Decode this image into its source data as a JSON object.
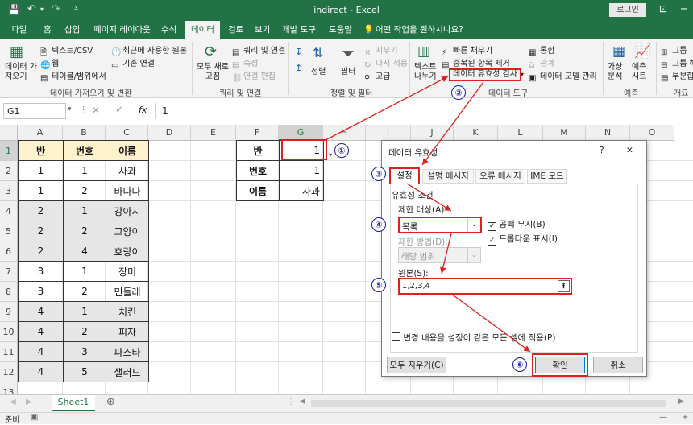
{
  "window": {
    "file": "indirect",
    "app": "Excel",
    "title_sep": "  -  ",
    "login": "로그인"
  },
  "tabs": [
    "파일",
    "홈",
    "삽입",
    "페이지 레이아웃",
    "수식",
    "데이터",
    "검토",
    "보기",
    "개발 도구",
    "도움말"
  ],
  "tell_me": "어떤 작업을 원하시나요?",
  "ribbon": {
    "get_data": "데이터 가\n져오기",
    "from_csv": "텍스트/CSV",
    "from_web": "웹",
    "from_table": "테이블/범위에서",
    "recent_sources": "최근에 사용한 원본",
    "existing_conn": "기존 연결",
    "refresh_all": "모두 새로\n고침",
    "queries_conn": "쿼리 및 연결",
    "properties": "속성",
    "edit_links": "연결 편집",
    "sort": "정렬",
    "filter": "필터",
    "clear": "지우기",
    "reapply": "다시 적용",
    "advanced": "고급",
    "text_to_columns": "텍스트\n나누기",
    "flash_fill": "빠른 채우기",
    "remove_duplicates": "중복된 항목 제거",
    "data_validation": "데이터 유효성 검사",
    "consolidate": "통합",
    "relationships": "관계",
    "data_model": "데이터 모델 관리",
    "what_if": "가상\n분석",
    "forecast_sheet": "예측\n시트",
    "group": "그룹",
    "ungroup": "그룹 해",
    "subtotal": "부분합",
    "groups": [
      "데이터 가져오기 및 변환",
      "쿼리 및 연결",
      "정렬 및 필터",
      "데이터 도구",
      "예측",
      "개요"
    ]
  },
  "formula_bar": {
    "name_box": "G1",
    "fx": "fx",
    "value": "1"
  },
  "columns": [
    "A",
    "B",
    "C",
    "D",
    "E",
    "F",
    "G",
    "H",
    "I",
    "J",
    "K",
    "L",
    "M",
    "N",
    "O"
  ],
  "rows": [
    "1",
    "2",
    "3",
    "4",
    "5",
    "6",
    "7",
    "8",
    "9",
    "10",
    "11",
    "12",
    "13"
  ],
  "table": {
    "headers": [
      "반",
      "번호",
      "이름"
    ],
    "rows": [
      [
        "1",
        "1",
        "사과"
      ],
      [
        "1",
        "2",
        "바나나"
      ],
      [
        "2",
        "1",
        "강아지"
      ],
      [
        "2",
        "2",
        "고양이"
      ],
      [
        "2",
        "4",
        "호랑이"
      ],
      [
        "3",
        "1",
        "장미"
      ],
      [
        "3",
        "2",
        "민들레"
      ],
      [
        "4",
        "1",
        "치킨"
      ],
      [
        "4",
        "2",
        "피자"
      ],
      [
        "4",
        "3",
        "파스타"
      ],
      [
        "4",
        "5",
        "샐러드"
      ]
    ]
  },
  "lookup": {
    "labels": [
      "반",
      "번호",
      "이름"
    ],
    "values": [
      "1",
      "1",
      "사과"
    ]
  },
  "dialog": {
    "title": "데이터 유효성",
    "help": "?",
    "close": "✕",
    "tabs": [
      "설정",
      "설명 메시지",
      "오류 메시지",
      "IME 모드"
    ],
    "section": "유효성 조건",
    "allow_label": "제한 대상(A):",
    "allow_value": "목록",
    "ignore_blank": "공백 무시(B)",
    "in_cell_dropdown": "드롭다운 표시(I)",
    "data_label": "제한 방법(D):",
    "data_value": "해당 범위",
    "source_label": "원본(S):",
    "source_value": "1,2,3,4",
    "apply_all": "변경 내용을 설정이 같은 모든 셀에 적용(P)",
    "clear_all": "모두 지우기(C)",
    "ok": "확인",
    "cancel": "취소"
  },
  "steps": [
    "①",
    "②",
    "③",
    "④",
    "⑤",
    "⑥"
  ],
  "sheet_tab": "Sheet1",
  "status": "준비",
  "colors": {
    "excel_green": "#217346",
    "header_fill": "#fff2cc",
    "grey_fill": "#e7e6e6",
    "annotation_red": "#e0201b",
    "step_blue": "#1a1aa6"
  }
}
